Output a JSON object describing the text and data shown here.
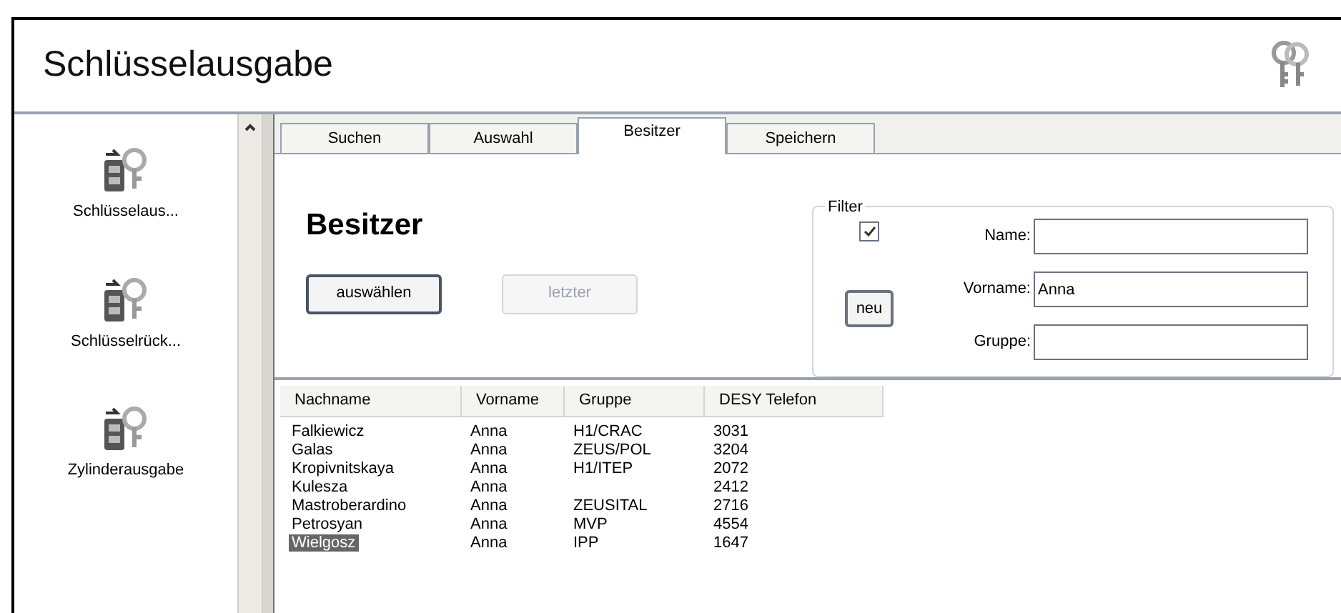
{
  "window": {
    "title": "Schlüsselausgabe"
  },
  "sidebar": {
    "items": [
      {
        "label": "Schlüsselaus...",
        "selected": false
      },
      {
        "label": "Schlüsselrück...",
        "selected": false
      },
      {
        "label": "Zylinderausgabe",
        "selected": false
      }
    ]
  },
  "tabs": [
    {
      "label": "Suchen",
      "selected": false
    },
    {
      "label": "Auswahl",
      "selected": false
    },
    {
      "label": "Besitzer",
      "selected": true
    },
    {
      "label": "Speichern",
      "selected": false
    }
  ],
  "heading": "Besitzer",
  "buttons": [
    {
      "label": "auswählen",
      "disabled": false
    },
    {
      "label": "letzter",
      "disabled": true
    }
  ],
  "filter": {
    "title": "Filter",
    "checked": true,
    "new_button": "neu",
    "fields": [
      {
        "label": "Name:"
      },
      {
        "label": "Vorname:",
        "value": "Anna"
      },
      {
        "label": "Gruppe:"
      }
    ]
  },
  "table": {
    "columns": [
      "Nachname",
      "Vorname",
      "Gruppe",
      "DESY Telefon"
    ],
    "rows": [
      {
        "cells": [
          "Falkiewicz",
          "Anna",
          "H1/CRAC",
          "3031"
        ],
        "selected": false
      },
      {
        "cells": [
          "Galas",
          "Anna",
          "ZEUS/POL",
          "3204"
        ],
        "selected": false
      },
      {
        "cells": [
          "Kropivnitskaya",
          "Anna",
          "H1/ITEP",
          "2072"
        ],
        "selected": false
      },
      {
        "cells": [
          "Kulesza",
          "Anna",
          null,
          "2412"
        ],
        "selected": false
      },
      {
        "cells": [
          "Mastroberardino",
          "Anna",
          "ZEUSITAL",
          "2716"
        ],
        "selected": false
      },
      {
        "cells": [
          "Petrosyan",
          "Anna",
          "MVP",
          "4554"
        ],
        "selected": false
      },
      {
        "cells": [
          "Wielgosz",
          "Anna",
          "IPP",
          "1647"
        ],
        "selected": true
      }
    ]
  }
}
